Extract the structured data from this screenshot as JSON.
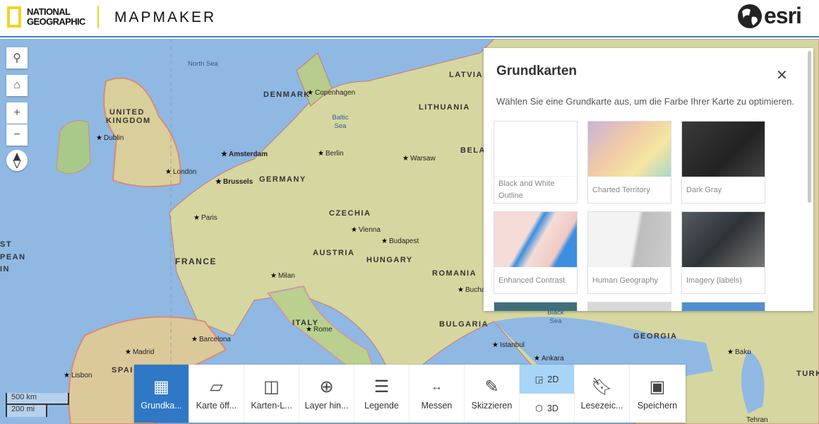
{
  "header": {
    "brand_line1": "NATIONAL",
    "brand_line2": "GEOGRAPHIC",
    "app_title": "MAPMAKER",
    "partner_logo": "esri"
  },
  "map_controls": {
    "search": "search-icon",
    "home": "home-icon",
    "zoom_in": "+",
    "zoom_out": "−",
    "compass": "compass-icon"
  },
  "scale": {
    "metric": "500 km",
    "imperial": "200 mi"
  },
  "map_labels": {
    "seas": [
      "North Sea",
      "Baltic Sea",
      "Black Sea"
    ],
    "countries": [
      "UNITED KINGDOM",
      "DENMARK",
      "LATVIA",
      "LITHUANIA",
      "GERMANY",
      "BELA",
      "CZECHIA",
      "AUSTRIA",
      "HUNGARY",
      "FRANCE",
      "ROMANIA",
      "ITALY",
      "BULGARIA",
      "SPAI",
      "GEORGIA",
      "TURK"
    ],
    "cities": [
      "Copenhagen",
      "Dublin",
      "London",
      "Amsterdam",
      "Berlin",
      "Warsaw",
      "Brussels",
      "Paris",
      "Vienna",
      "Budapest",
      "Milan",
      "Bucha",
      "Rome",
      "Barcelona",
      "Madrid",
      "Lisbon",
      "Istanbul",
      "Ankara",
      "Baku",
      "Tehran"
    ],
    "edge": [
      "ST",
      "PEAN",
      "IN"
    ]
  },
  "basemap_panel": {
    "title": "Grundkarten",
    "description": "Wählen Sie eine Grundkarte aus, um die Farbe Ihrer Karte zu optimieren.",
    "items": [
      {
        "name": "Black and White Outline",
        "color": "#ffffff"
      },
      {
        "name": "Charted Territory",
        "color": "#e8d9c8"
      },
      {
        "name": "Dark Gray",
        "color": "#333333"
      },
      {
        "name": "Enhanced Contrast",
        "color": "#f4d7d2"
      },
      {
        "name": "Human Geography",
        "color": "#e8e8e8"
      },
      {
        "name": "Imagery (labels)",
        "color": "#4a5058"
      }
    ]
  },
  "toolbar": {
    "items": [
      {
        "label": "Grundka...",
        "icon": "basemap-gallery-icon",
        "active": true
      },
      {
        "label": "Karte öff...",
        "icon": "open-map-icon"
      },
      {
        "label": "Karten-L...",
        "icon": "map-layers-icon"
      },
      {
        "label": "Layer hin...",
        "icon": "add-layer-icon"
      },
      {
        "label": "Legende",
        "icon": "legend-icon"
      },
      {
        "label": "Messen",
        "icon": "measure-icon"
      },
      {
        "label": "Skizzieren",
        "icon": "sketch-icon"
      }
    ],
    "view_2d": "2D",
    "view_3d": "3D",
    "view_selected": "2D",
    "bookmarks": "Lesezeic...",
    "save": "Speichern",
    "accent": "#2f78c5"
  }
}
